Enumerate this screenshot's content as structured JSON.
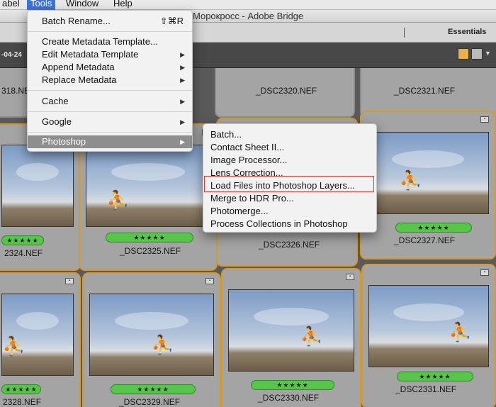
{
  "menubar": {
    "label": "abel",
    "tools": "Tools",
    "window": "Window",
    "help": "Help"
  },
  "window": {
    "title": "Морокросс - Adobe Bridge"
  },
  "toolbar": {
    "workspace": "Essentials",
    "date": "-04-24"
  },
  "tools_menu": {
    "batch_rename": "Batch Rename...",
    "batch_rename_shortcut": "⇧⌘R",
    "create_metadata_template": "Create Metadata Template...",
    "edit_metadata_template": "Edit Metadata Template",
    "append_metadata": "Append Metadata",
    "replace_metadata": "Replace Metadata",
    "cache": "Cache",
    "google": "Google",
    "photoshop": "Photoshop"
  },
  "photoshop_submenu": {
    "batch": "Batch...",
    "contact_sheet": "Contact Sheet II...",
    "image_processor": "Image Processor...",
    "lens_correction": "Lens Correction...",
    "load_files_layers": "Load Files into Photoshop Layers...",
    "merge_hdr": "Merge to HDR Pro...",
    "photomerge": "Photomerge...",
    "process_collections": "Process Collections in Photoshop"
  },
  "thumbnails": {
    "row1": [
      "318.NEF",
      "_DSC2320.NEF",
      "_DSC2321.NEF"
    ],
    "row2": [
      "2324.NEF",
      "_DSC2325.NEF",
      "_DSC2326.NEF",
      "_DSC2327.NEF"
    ],
    "row3": [
      "2328.NEF",
      "_DSC2329.NEF",
      "_DSC2330.NEF",
      "_DSC2331.NEF"
    ],
    "stars": "★★★★★"
  },
  "colors": {
    "selection_border": "#d49a2e",
    "rating_green": "#57c44a",
    "menu_highlight": "#8e8e8e",
    "callout_red": "#d63c3c"
  }
}
